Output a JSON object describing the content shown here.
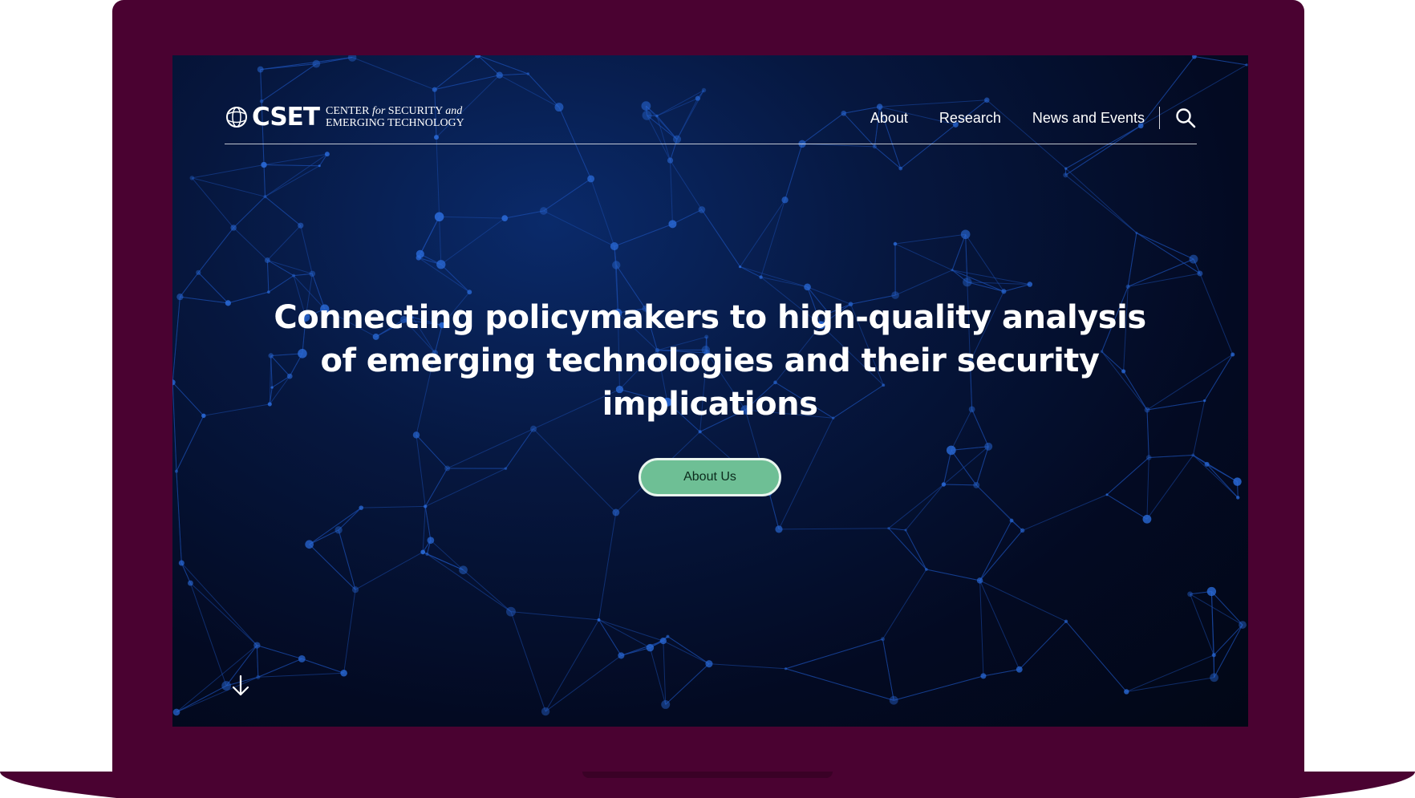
{
  "brand": {
    "wordmark": "CSET",
    "sub_line1_a": "CENTER",
    "sub_line1_b": "for",
    "sub_line1_c": "SECURITY",
    "sub_line1_d": "and",
    "sub_line2": "EMERGING TECHNOLOGY",
    "logo_icon": "globe-icon"
  },
  "nav": {
    "items": [
      {
        "label": "About"
      },
      {
        "label": "Research"
      },
      {
        "label": "News and Events"
      }
    ],
    "search_icon": "search-icon"
  },
  "hero": {
    "title_line1": "Connecting policymakers to high-quality analysis",
    "title_line2": "of emerging technologies and their security",
    "title_line3": "implications",
    "cta_label": "About Us",
    "scroll_icon": "arrow-down-icon"
  },
  "colors": {
    "device_frame": "#4a0231",
    "background_dark": "#030a22",
    "network_node": "#2a6ad8",
    "cta_fill": "#6ebf95",
    "text": "#ffffff"
  }
}
